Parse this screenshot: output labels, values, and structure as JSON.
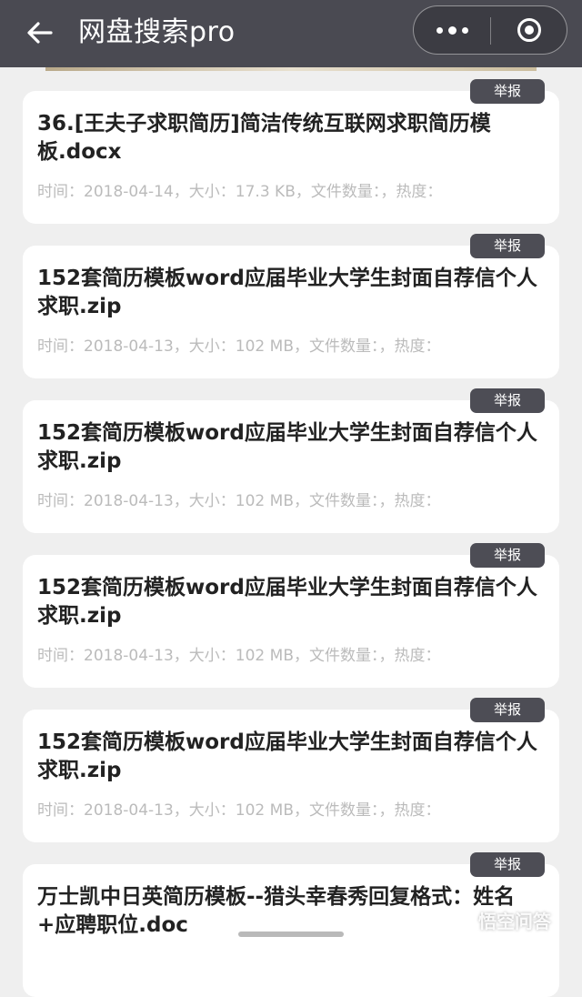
{
  "header": {
    "title": "网盘搜索pro",
    "back_icon": "arrow-left-icon",
    "more_icon": "more-dots-icon",
    "close_icon": "target-close-icon"
  },
  "report_label": "举报",
  "results": [
    {
      "title": "36.[王夫子求职简历]简洁传统互联网求职简历模板.docx",
      "meta": "时间：2018-04-14，大小：17.3 KB，文件数量：，热度："
    },
    {
      "title": "152套简历模板word应届毕业大学生封面自荐信个人求职.zip",
      "meta": "时间：2018-04-13，大小：102 MB，文件数量：，热度："
    },
    {
      "title": "152套简历模板word应届毕业大学生封面自荐信个人求职.zip",
      "meta": "时间：2018-04-13，大小：102 MB，文件数量：，热度："
    },
    {
      "title": "152套简历模板word应届毕业大学生封面自荐信个人求职.zip",
      "meta": "时间：2018-04-13，大小：102 MB，文件数量：，热度："
    },
    {
      "title": "152套简历模板word应届毕业大学生封面自荐信个人求职.zip",
      "meta": "时间：2018-04-13，大小：102 MB，文件数量：，热度："
    },
    {
      "title": "万士凯中日英简历模板--猎头幸春秀回复格式：姓名+应聘职位.doc",
      "meta": ""
    }
  ],
  "watermark": "悟空问答",
  "colors": {
    "topbar": "#4a4a52",
    "background": "#efefef",
    "card": "#ffffff",
    "report_button": "#4d4d55",
    "meta_text": "#bbbbbb"
  }
}
